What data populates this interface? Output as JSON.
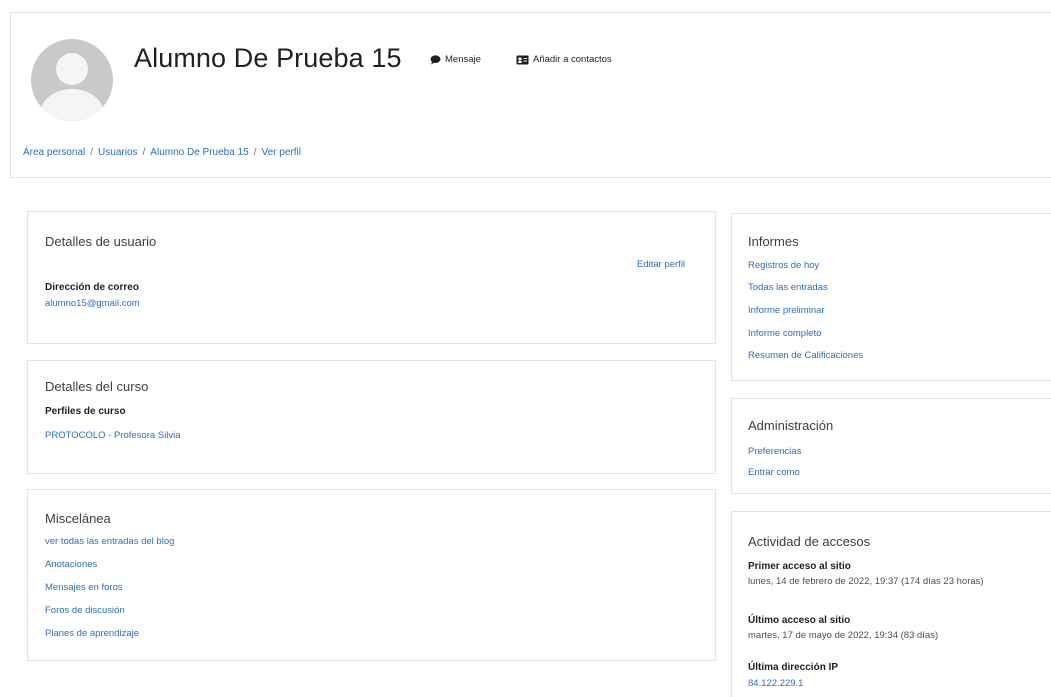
{
  "header": {
    "user_name": "Alumno De Prueba 15",
    "message_label": "Mensaje",
    "add_contact_label": "Añadir a contactos",
    "breadcrumb": [
      "Área personal",
      "Usuarios",
      "Alumno De Prueba 15",
      "Ver perfil"
    ],
    "breadcrumb_separator": "/"
  },
  "user_details": {
    "title": "Detalles de usuario",
    "edit_profile": "Editar perfil",
    "email_label": "Dirección de correo",
    "email_value": "alumno15@gmail.com"
  },
  "course_details": {
    "title": "Detalles del curso",
    "profiles_label": "Perfiles de curso",
    "course_link": "PROTOCOLO - Profesora Silvia"
  },
  "misc": {
    "title": "Miscelánea",
    "links": [
      "ver todas las entradas del blog",
      "Anotaciones",
      "Mensajes en foros",
      "Foros de discusión",
      "Planes de aprendizaje"
    ]
  },
  "reports": {
    "title": "Informes",
    "links": [
      "Registros de hoy",
      "Todas las entradas",
      "Informe preliminar",
      "Informe completo",
      "Resumen de Calificaciones"
    ]
  },
  "administration": {
    "title": "Administración",
    "links": [
      "Preferencias",
      "Entrar como"
    ]
  },
  "access_activity": {
    "title": "Actividad de accesos",
    "first_access_label": "Primer acceso al sitio",
    "first_access_value": "lunes, 14 de febrero de 2022, 19:37  (174 días 23 horas)",
    "last_access_label": "Último acceso al sitio",
    "last_access_value": "martes, 17 de mayo de 2022, 19:34  (83 días)",
    "last_ip_label": "Última dirección IP",
    "last_ip_value": "84.122.229.1"
  },
  "colors": {
    "link": "#2f6fb8",
    "text": "#1d2125",
    "border": "#e3e4e6"
  },
  "icons": {
    "message": "speech-bubble-icon",
    "add_contact": "address-card-icon"
  }
}
